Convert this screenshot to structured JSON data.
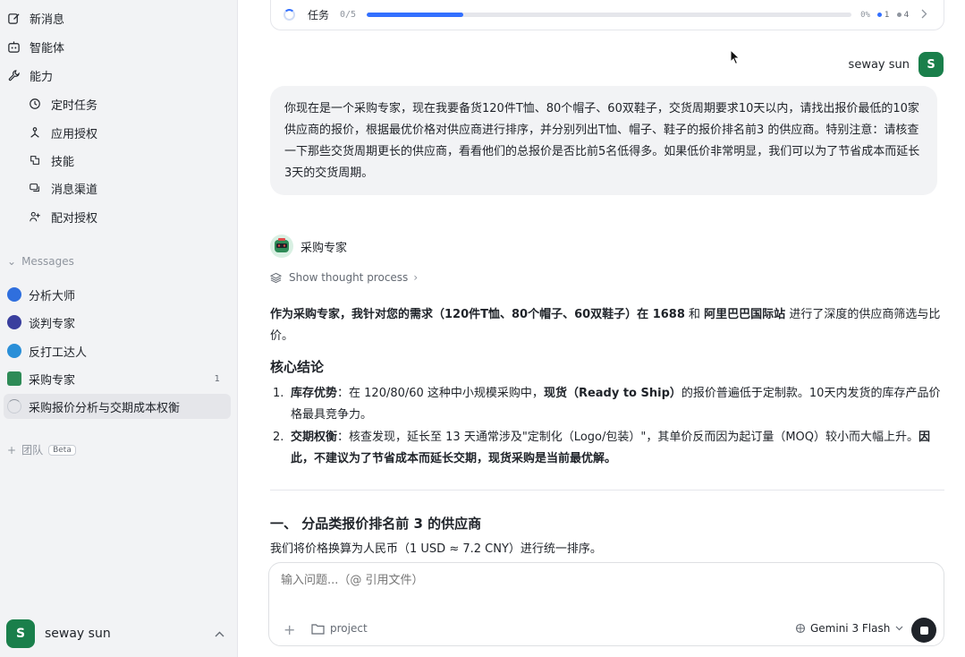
{
  "sidebar": {
    "nav": [
      {
        "label": "新消息",
        "icon": "edit-icon"
      },
      {
        "label": "智能体",
        "icon": "robot-icon"
      },
      {
        "label": "能力",
        "icon": "wrench-icon"
      }
    ],
    "sub_nav": [
      {
        "label": "定时任务",
        "icon": "clock-icon"
      },
      {
        "label": "应用授权",
        "icon": "app-auth-icon"
      },
      {
        "label": "技能",
        "icon": "skill-icon"
      },
      {
        "label": "消息渠道",
        "icon": "chat-channel-icon"
      },
      {
        "label": "配对授权",
        "icon": "pair-user-icon"
      }
    ],
    "messages_label": "Messages",
    "messages": [
      {
        "label": "分析大师",
        "color": "#2f6fde"
      },
      {
        "label": "谈判专家",
        "color": "#3a3f9e"
      },
      {
        "label": "反打工达人",
        "color": "#2a8fd8"
      },
      {
        "label": "采购专家",
        "color": "#2e8b57",
        "badge": "1"
      },
      {
        "label": "采购报价分析与交期成本权衡",
        "active": true
      }
    ],
    "team_label": "团队",
    "beta_label": "Beta",
    "user": {
      "initial": "S",
      "name": "seway sun"
    }
  },
  "taskbar": {
    "label": "任务",
    "count": "0/5",
    "progress": 0.2,
    "percent": "0%",
    "done": "1",
    "total": "4",
    "accent": "#3370ff"
  },
  "chat": {
    "user": {
      "name": "seway sun",
      "initial": "S"
    },
    "user_message": "你现在是一个采购专家，现在我要备货120件T恤、80个帽子、60双鞋子，交货周期要求10天以内，请找出报价最低的10家供应商的报价，根据最优价格对供应商进行排序，并分别列出T恤、帽子、鞋子的报价排名前3 的供应商。特别注意：请核查一下那些交货周期更长的供应商，看看他们的总报价是否比前5名低得多。如果低价非常明显，我们可以为了节省成本而延长3天的交货周期。",
    "agent_name": "采购专家",
    "thought_label": "Show thought process",
    "intro": {
      "p1": "作为采购专家，我针对您的需求（120件T恤、80个帽子、60双鞋子）在 ",
      "b1": "1688",
      "p2": " 和 ",
      "b2": "阿里巴巴国际站",
      "p3": " 进行了深度的供应商筛选与比价。"
    },
    "core_title": "核心结论",
    "points": [
      {
        "num": "1.",
        "b": "库存优势",
        "t1": "：在 120/80/60 这种中小规模采购中，",
        "b2": "现货（Ready to Ship）",
        "t2": "的报价普遍低于定制款。10天内发货的库存产品价格最具竞争力。"
      },
      {
        "num": "2.",
        "b": "交期权衡",
        "t1": "：核查发现，延长至 13 天通常涉及\"定制化（Logo/包装）\"，其单价反而因为起订量（MOQ）较小而大幅上升。",
        "b2": "因此，不建议为了节省成本而延长交期，现货采购是当前最优解。"
      }
    ],
    "section1_title": "一、 分品类报价排名前 3 的供应商",
    "section1_text": "我们将价格换算为人民币（1 USD ≈ 7.2 CNY）进行统一排序。"
  },
  "composer": {
    "placeholder": "输入问题...（@ 引用文件）",
    "project_label": "project",
    "model_label": "Gemini 3 Flash"
  }
}
